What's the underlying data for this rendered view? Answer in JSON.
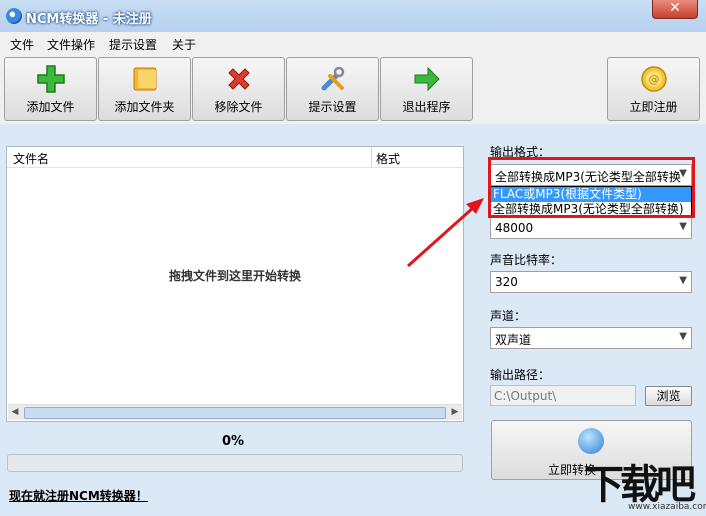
{
  "window": {
    "title": "NCM转换器 - 未注册",
    "close": "✕"
  },
  "menu": [
    "文件",
    "文件操作",
    "提示设置",
    "关于"
  ],
  "toolbar": {
    "add_file": "添加文件",
    "add_folder": "添加文件夹",
    "remove_file": "移除文件",
    "prompt_settings": "提示设置",
    "exit": "退出程序",
    "register": "立即注册"
  },
  "file_list": {
    "columns": [
      "文件名",
      "格式"
    ],
    "drop_hint": "拖拽文件到这里开始转换"
  },
  "progress": {
    "percent_text": "0%",
    "value": 0
  },
  "register_link": "现在就注册NCM转换器！",
  "settings": {
    "output_format_label": "输出格式：",
    "output_format_value": "全部转换成MP3(无论类型全部转换",
    "output_format_options": [
      "FLAC或MP3(根据文件类型)",
      "全部转换成MP3(无论类型全部转换)"
    ],
    "sample_rate_value": "48000",
    "bitrate_label": "声音比特率：",
    "bitrate_value": "320",
    "channel_label": "声道：",
    "channel_value": "双声道",
    "output_path_label": "输出路径：",
    "output_path_value": "C:\\Output\\",
    "browse": "浏览",
    "convert": "立即转换"
  },
  "watermark": {
    "text": "下载吧",
    "url": "www.xiazaiba.com"
  },
  "colors": {
    "highlight": "#e0161b",
    "selection": "#3399ff",
    "progress": "#3aa43a"
  },
  "icons": [
    "app-icon",
    "add-icon",
    "folder-icon",
    "remove-icon",
    "settings-icon",
    "exit-arrow-icon",
    "coin-icon",
    "convert-icon",
    "chevron-down-icon",
    "scroll-left-icon",
    "scroll-right-icon"
  ]
}
